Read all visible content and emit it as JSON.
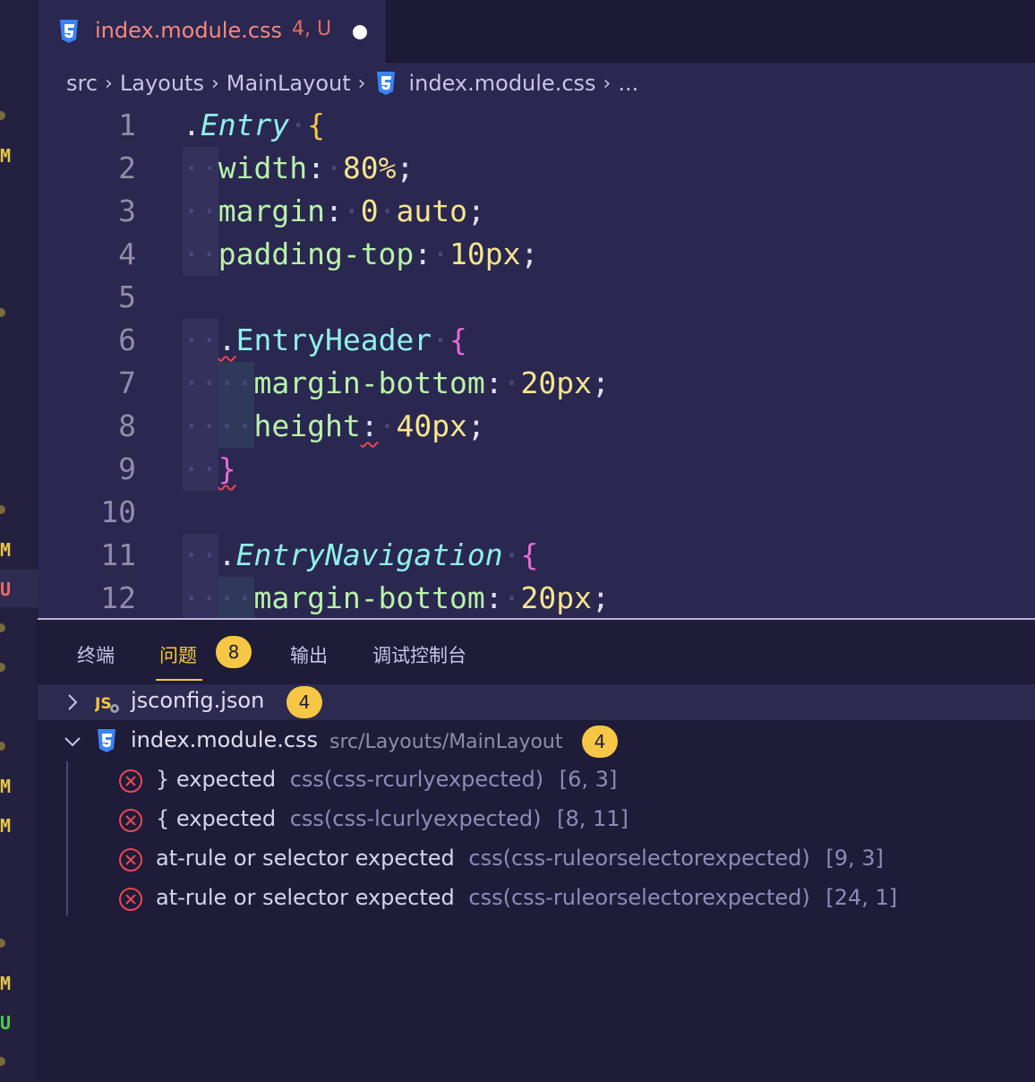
{
  "colors": {
    "accent": "#f6c744",
    "tab_title": "#f5897c",
    "error": "#e84855",
    "css_icon": "#3b82f6"
  },
  "sidebar": {
    "marks": [
      {
        "text": "M",
        "color": "#e8c547"
      },
      {
        "text": "M",
        "color": "#e8c547"
      },
      {
        "text": "U",
        "color": "#e86a6a"
      },
      {
        "text": "M",
        "color": "#e8c547"
      },
      {
        "text": "M",
        "color": "#e8c547"
      },
      {
        "text": "M",
        "color": "#e8c547"
      },
      {
        "text": "U",
        "color": "#4ec94e"
      }
    ]
  },
  "tab": {
    "icon": "css3-icon",
    "title": "index.module.css",
    "status": "4, U"
  },
  "breadcrumb": {
    "items": [
      "src",
      "Layouts",
      "MainLayout",
      "index.module.css",
      "..."
    ]
  },
  "editor": {
    "line_numbers": [
      "1",
      "2",
      "3",
      "4",
      "5",
      "6",
      "7",
      "8",
      "9",
      "10",
      "11",
      "12"
    ]
  },
  "panel": {
    "tabs": [
      "终端",
      "问题",
      "输出",
      "调试控制台"
    ],
    "problem_count": "8",
    "files": [
      {
        "icon": "js-config-icon",
        "name": "jsconfig.json",
        "path": "",
        "count": "4",
        "expanded": false
      },
      {
        "icon": "css3-icon",
        "name": "index.module.css",
        "path": "src/Layouts/MainLayout",
        "count": "4",
        "expanded": true
      }
    ],
    "errors": [
      {
        "message": "} expected",
        "code": "css(css-rcurlyexpected)",
        "position": "[6, 3]"
      },
      {
        "message": "{ expected",
        "code": "css(css-lcurlyexpected)",
        "position": "[8, 11]"
      },
      {
        "message": "at-rule or selector expected",
        "code": "css(css-ruleorselectorexpected)",
        "position": "[9, 3]"
      },
      {
        "message": "at-rule or selector expected",
        "code": "css(css-ruleorselectorexpected)",
        "position": "[24, 1]"
      }
    ]
  }
}
